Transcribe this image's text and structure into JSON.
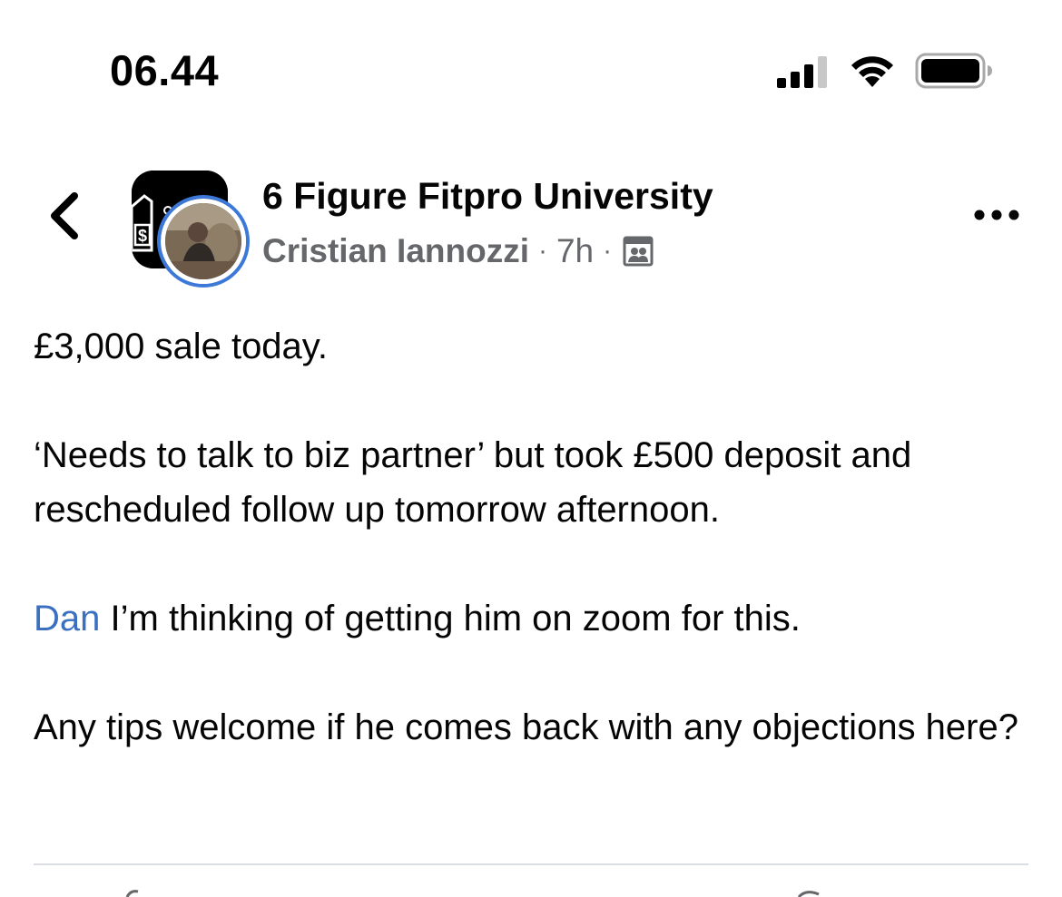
{
  "status_bar": {
    "time": "06.44",
    "signal_icon": "cellular-signal-icon",
    "wifi_icon": "wifi-icon",
    "battery_icon": "battery-icon"
  },
  "header": {
    "back_icon": "chevron-left-icon",
    "group_name": "6 Figure Fitpro University",
    "author": "Cristian Iannozzi",
    "separator": "·",
    "time_ago": "7h",
    "audience_icon": "group-members-icon",
    "more_icon": "more-horizontal-icon"
  },
  "post": {
    "paragraph_1": "£3,000 sale today.",
    "paragraph_2": "‘Needs to talk to biz partner’ but took £500 deposit and rescheduled follow up tomorrow afternoon.",
    "mention": "Dan",
    "paragraph_3_rest": " I’m thinking of getting him on zoom for this.",
    "paragraph_4": "Any tips welcome if he comes back with any objections here?"
  },
  "colors": {
    "mention": "#3b6fc0",
    "meta_text": "#65676b",
    "avatar_ring": "#3b78d8"
  }
}
